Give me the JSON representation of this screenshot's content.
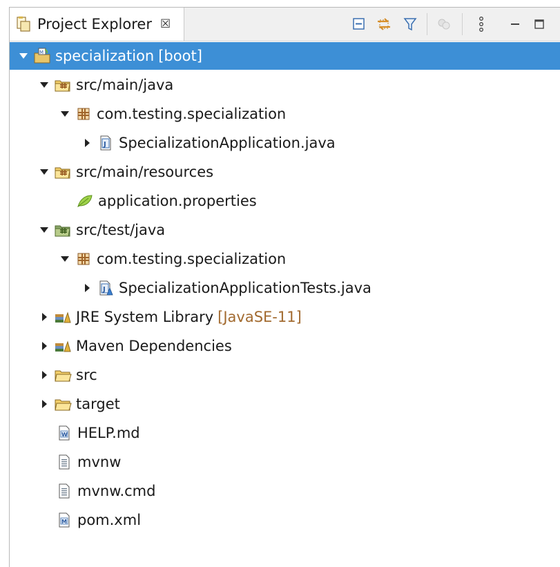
{
  "view": {
    "title": "Project Explorer",
    "close_glyph": "☒"
  },
  "toolbar": {
    "buttons": [
      {
        "name": "collapse-all-icon"
      },
      {
        "name": "link-with-editor-icon"
      },
      {
        "name": "filter-icon"
      },
      {
        "name": "disabled-action-icon"
      },
      {
        "name": "view-menu-icon"
      },
      {
        "name": "minimize-icon"
      },
      {
        "name": "maximize-icon"
      }
    ]
  },
  "tree": {
    "items": [
      {
        "label": "specialization",
        "decoration": "[boot]",
        "icon": "spring-project-icon",
        "expanded": true,
        "selected": true
      },
      {
        "label": "src/main/java",
        "icon": "source-folder-icon",
        "expanded": true
      },
      {
        "label": "com.testing.specialization",
        "icon": "package-icon",
        "expanded": true
      },
      {
        "label": "SpecializationApplication.java",
        "icon": "java-file-icon",
        "expanded": false
      },
      {
        "label": "src/main/resources",
        "icon": "source-folder-icon",
        "expanded": true
      },
      {
        "label": "application.properties",
        "icon": "spring-properties-icon"
      },
      {
        "label": "src/test/java",
        "icon": "test-source-folder-icon",
        "expanded": true
      },
      {
        "label": "com.testing.specialization",
        "icon": "package-icon",
        "expanded": true
      },
      {
        "label": "SpecializationApplicationTests.java",
        "icon": "java-test-file-icon",
        "expanded": false
      },
      {
        "label": "JRE System Library",
        "decoration": "[JavaSE-11]",
        "icon": "library-icon",
        "expanded": false
      },
      {
        "label": "Maven Dependencies",
        "icon": "library-icon",
        "expanded": false
      },
      {
        "label": "src",
        "icon": "folder-icon",
        "expanded": false
      },
      {
        "label": "target",
        "icon": "folder-icon",
        "expanded": false
      },
      {
        "label": "HELP.md",
        "icon": "markdown-file-icon"
      },
      {
        "label": "mvnw",
        "icon": "text-file-icon"
      },
      {
        "label": "mvnw.cmd",
        "icon": "text-file-icon"
      },
      {
        "label": "pom.xml",
        "icon": "maven-pom-icon"
      }
    ]
  },
  "colors": {
    "selection": "#3d8fd6",
    "decoration": "#a26a2f"
  }
}
